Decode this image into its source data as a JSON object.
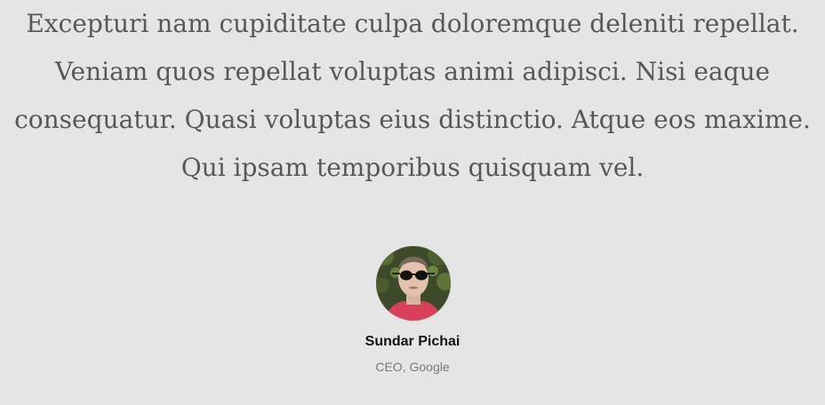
{
  "testimonial": {
    "quote_lines": [
      "Excepturi nam cupiditate culpa doloremque deleniti repellat.",
      "Veniam quos repellat voluptas animi adipisci. Nisi eaque",
      "consequatur. Quasi voluptas eius distinctio. Atque eos maxime.",
      "Qui ipsam temporibus quisquam vel."
    ],
    "author_name": "Sundar Pichai",
    "author_role": "CEO, Google"
  },
  "colors": {
    "background": "#e5e5e5",
    "quote_text": "#585858",
    "name_text": "#111111",
    "role_text": "#7a7a7a"
  }
}
